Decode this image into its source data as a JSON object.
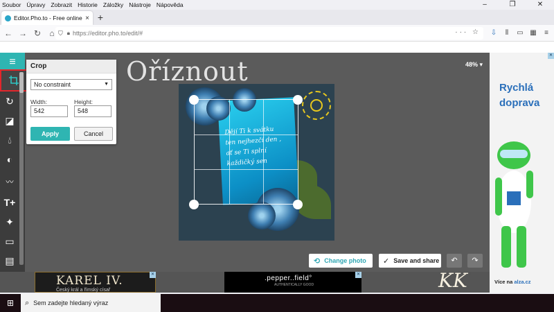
{
  "browser": {
    "menu": [
      "Soubor",
      "Úpravy",
      "Zobrazit",
      "Historie",
      "Záložky",
      "Nástroje",
      "Nápověda"
    ],
    "window_controls": [
      "–",
      "❐",
      "✕"
    ],
    "tab_title": "Editor.Pho.to - Free online photo",
    "tab_close": "×",
    "new_tab": "+",
    "url": "https://editor.pho.to/edit/#",
    "url_actions": "··· ☆",
    "nav_icons": [
      "⇩",
      "⫴",
      "▭",
      "▦",
      "≡"
    ]
  },
  "editor": {
    "overlay_title": "Oříznout",
    "zoom": "48% ▾",
    "crop_panel": {
      "title": "Crop",
      "constraint": "No constraint",
      "width_label": "Width:",
      "width_value": "542",
      "height_label": "Height:",
      "height_value": "548",
      "apply": "Apply",
      "cancel": "Cancel"
    },
    "card_lines": [
      "Dějí Ti k svátku",
      "ten nejhezčí den ,",
      "ať se Ti splní",
      "každičký sen"
    ],
    "buttons": {
      "change_photo": "Change photo",
      "save_share": "Save and share",
      "undo": "↶",
      "redo": "↷"
    },
    "tools": [
      "menu-icon",
      "crop-icon",
      "rotate-icon",
      "exposure-icon",
      "color-icon",
      "contrast-icon",
      "mustache-icon",
      "text-icon",
      "magic-wand-icon",
      "frame-icon",
      "texture-icon"
    ]
  },
  "ads": {
    "right_title_1": "Rychlá",
    "right_title_2": "doprava",
    "right_footer": "Více na",
    "right_brand": "alza.cz",
    "karel_title": "KAREL IV.",
    "karel_sub": "Český král a římský císař",
    "pepper_title": ".pepper..field°",
    "pepper_sub": "AUTHENTICALLY GOOD",
    "ad_close": "✕"
  },
  "watermark": "KK",
  "taskbar": {
    "search_placeholder": "Sem zadejte hledaný výraz"
  },
  "colors": {
    "accent": "#2fb5b2",
    "active_tool_border": "#e3262b",
    "canvas_bg": "#5b5b5b"
  }
}
